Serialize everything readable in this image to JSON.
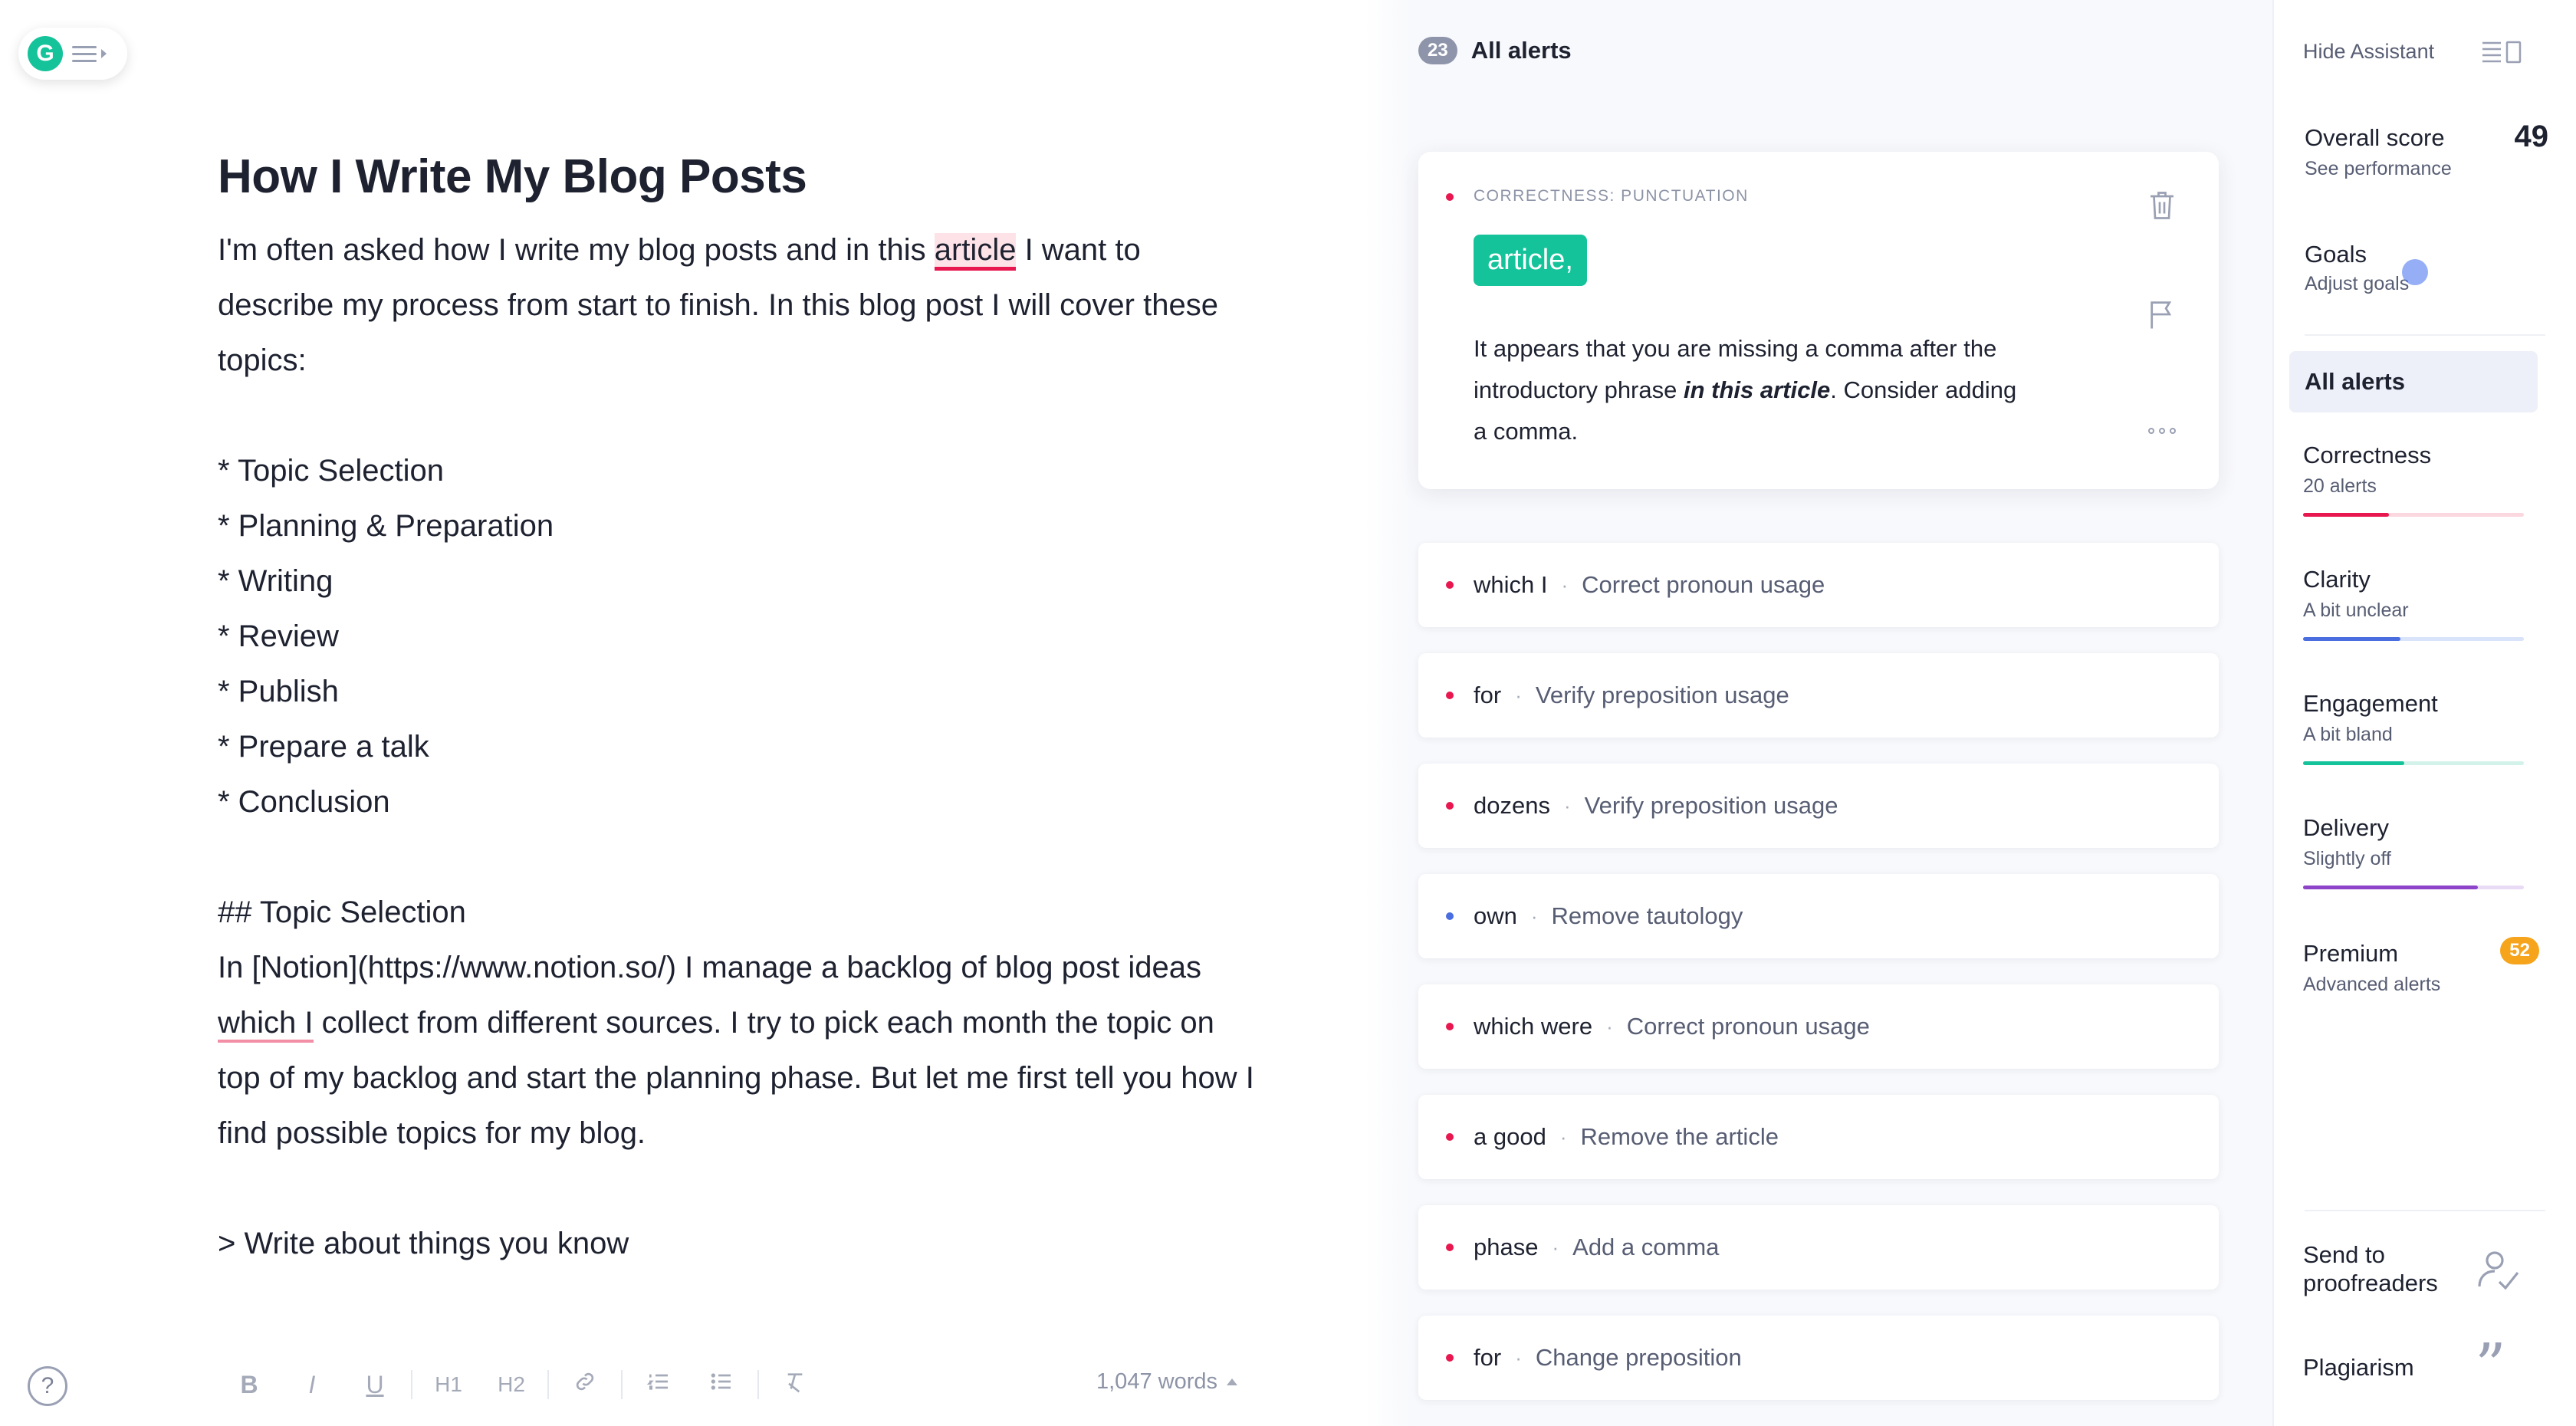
{
  "editor": {
    "logo_letter": "G",
    "title": "How I Write My Blog Posts",
    "intro_before": "I'm often asked how I write my blog posts and in this ",
    "intro_highlight": "article",
    "intro_after": " I want to describe my process from start to finish. In this blog post I will cover these topics:",
    "topics": [
      "* Topic Selection",
      "* Planning & Preparation",
      "* Writing",
      "* Review",
      "* Publish",
      "* Prepare a talk",
      "* Conclusion"
    ],
    "heading2": "## Topic Selection",
    "para2_before": "In [Notion](https://www.notion.so/) I manage a backlog of blog post ideas ",
    "para2_underline": "which I",
    "para2_after": " collect from different sources. I try to pick each month the topic on top of my backlog and start the planning phase. But let me first tell you how I find possible topics for my blog.",
    "quote": "> Write about things you know",
    "toolbar": {
      "bold": "B",
      "italic": "I",
      "underline": "U",
      "h1": "H1",
      "h2": "H2",
      "word_count": "1,047 words"
    },
    "help": "?"
  },
  "alerts": {
    "count": "23",
    "title": "All alerts",
    "card": {
      "category": "CORRECTNESS: PUNCTUATION",
      "suggestion": "article,",
      "text_before": "It appears that you are missing a comma after the introductory phrase ",
      "text_em": "in this article",
      "text_after": ". Consider adding a comma."
    },
    "list": [
      {
        "word": "which I",
        "desc": "Correct pronoun usage",
        "color": "#e8174f"
      },
      {
        "word": "for",
        "desc": "Verify preposition usage",
        "color": "#e8174f"
      },
      {
        "word": "dozens",
        "desc": "Verify preposition usage",
        "color": "#e8174f"
      },
      {
        "word": "own",
        "desc": "Remove tautology",
        "color": "#4a6ee0"
      },
      {
        "word": "which were",
        "desc": "Correct pronoun usage",
        "color": "#e8174f"
      },
      {
        "word": "a good",
        "desc": "Remove the article",
        "color": "#e8174f"
      },
      {
        "word": "phase",
        "desc": "Add a comma",
        "color": "#e8174f"
      },
      {
        "word": "for",
        "desc": "Change preposition",
        "color": "#e8174f"
      }
    ]
  },
  "sidebar": {
    "hide_assistant": "Hide Assistant",
    "overall_score_label": "Overall score",
    "overall_score": "49",
    "see_performance": "See performance",
    "goals": "Goals",
    "adjust_goals": "Adjust goals",
    "all_alerts": "All alerts",
    "categories": [
      {
        "name": "Correctness",
        "sub": "20 alerts",
        "fill": 0.39,
        "color": "#e8174f",
        "track": "#fbd7e0"
      },
      {
        "name": "Clarity",
        "sub": "A bit unclear",
        "fill": 0.44,
        "color": "#4a6ee0",
        "track": "#d9e3fa"
      },
      {
        "name": "Engagement",
        "sub": "A bit bland",
        "fill": 0.46,
        "color": "#15c39a",
        "track": "#d3f3ea"
      },
      {
        "name": "Delivery",
        "sub": "Slightly off",
        "fill": 0.79,
        "color": "#8e44c9",
        "track": "#e9dbf5"
      }
    ],
    "premium": "Premium",
    "premium_count": "52",
    "advanced_alerts": "Advanced alerts",
    "send_to_proofreaders": "Send to proofreaders",
    "plagiarism": "Plagiarism"
  }
}
